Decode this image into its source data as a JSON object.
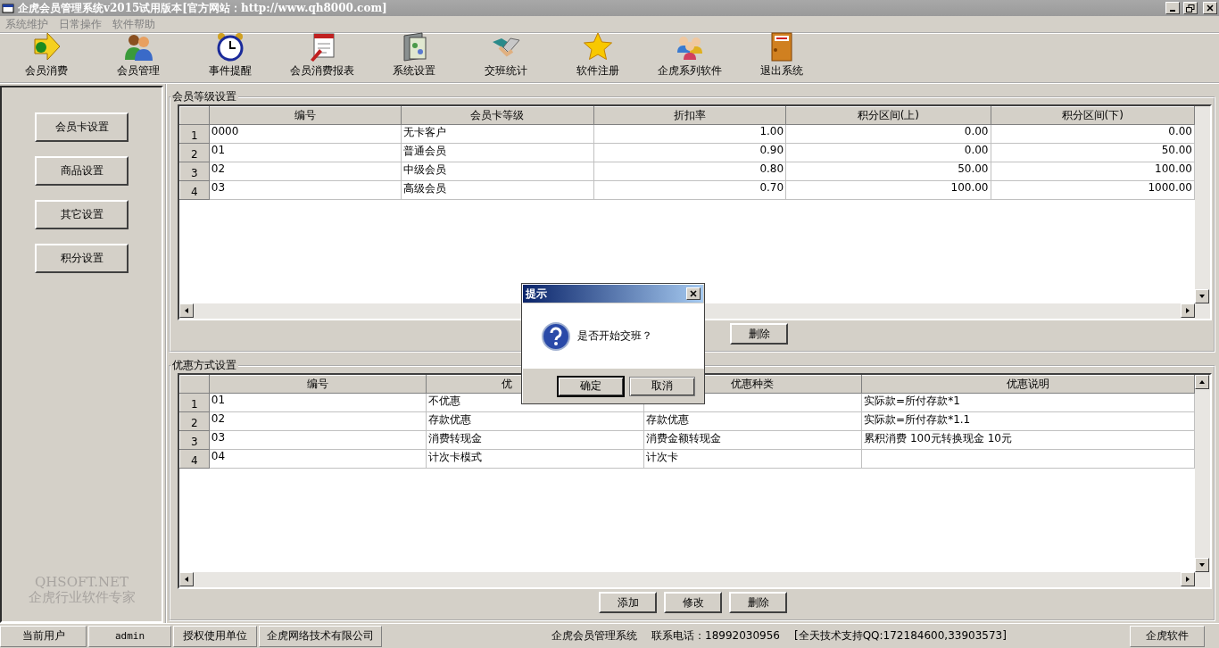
{
  "window": {
    "title": "企虎会员管理系统v2015试用版本[官方网站：http://www.qh8000.com]"
  },
  "menu": [
    "系统维护",
    "日常操作",
    "软件帮助"
  ],
  "toolbar": [
    {
      "label": "会员消费",
      "kind": "money"
    },
    {
      "label": "会员管理",
      "kind": "people"
    },
    {
      "label": "事件提醒",
      "kind": "clock"
    },
    {
      "label": "会员消费报表",
      "kind": "report"
    },
    {
      "label": "系统设置",
      "kind": "settings"
    },
    {
      "label": "交班统计",
      "kind": "handshake"
    },
    {
      "label": "软件注册",
      "kind": "star"
    },
    {
      "label": "企虎系列软件",
      "kind": "group"
    },
    {
      "label": "退出系统",
      "kind": "exit"
    }
  ],
  "sidebar": {
    "buttons": [
      "会员卡设置",
      "商品设置",
      "其它设置",
      "积分设置"
    ],
    "brand": [
      "QHSOFT.NET",
      "企虎行业软件专家"
    ]
  },
  "level_section": {
    "title": "会员等级设置",
    "columns": [
      "编号",
      "会员卡等级",
      "折扣率",
      "积分区间(上)",
      "积分区间(下)"
    ],
    "rows": [
      {
        "index": "1",
        "cells": [
          "0000",
          "无卡客户",
          "1.00",
          "0.00",
          "0.00"
        ]
      },
      {
        "index": "2",
        "cells": [
          "01",
          "普通会员",
          "0.90",
          "0.00",
          "50.00"
        ]
      },
      {
        "index": "3",
        "cells": [
          "02",
          "中级会员",
          "0.80",
          "50.00",
          "100.00"
        ]
      },
      {
        "index": "4",
        "cells": [
          "03",
          "高级会员",
          "0.70",
          "100.00",
          "1000.00"
        ]
      }
    ],
    "buttons": [
      "删除"
    ]
  },
  "discount_section": {
    "title": "优惠方式设置",
    "columns": [
      "编号",
      "优",
      "优惠种类",
      "优惠说明"
    ],
    "rows": [
      {
        "index": "1",
        "cells": [
          "01",
          "不优惠",
          null,
          "实际款=所付存款*1"
        ]
      },
      {
        "index": "2",
        "cells": [
          "02",
          "存款优惠",
          "存款优惠",
          "实际款=所付存款*1.1"
        ]
      },
      {
        "index": "3",
        "cells": [
          "03",
          "消费转现金",
          "消费金额转现金",
          "累积消费 100元转换现金 10元"
        ]
      },
      {
        "index": "4",
        "cells": [
          "04",
          "计次卡模式",
          "计次卡",
          null
        ]
      }
    ],
    "buttons": [
      "添加",
      "修改",
      "删除"
    ]
  },
  "dialog": {
    "title": "提示",
    "message": "是否开始交班？",
    "buttons": [
      {
        "label": "确定",
        "default": true
      },
      {
        "label": "取消",
        "default": false
      }
    ]
  },
  "status_bar": {
    "cells": [
      "当前用户",
      "admin",
      "授权使用单位",
      "企虎网络技术有限公司"
    ],
    "info": [
      "企虎会员管理系统",
      "联系电话：18992030956",
      "[全天技术支持QQ:172184600,33903573]"
    ],
    "button": "企虎软件"
  }
}
